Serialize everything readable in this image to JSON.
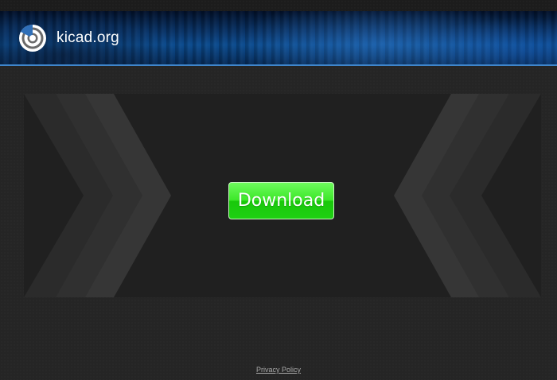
{
  "header": {
    "brand": "kicad.org",
    "logo_icon": "kicad-logo-icon"
  },
  "main": {
    "download_label": "Download"
  },
  "footer": {
    "privacy_label": "Privacy Policy"
  },
  "colors": {
    "header_bg": "#0a3a73",
    "header_line": "#3f86cc",
    "page_bg": "#252525",
    "stage_bg": "#202020",
    "button_green": "#3de82a",
    "chevron_gray": "#333333"
  }
}
